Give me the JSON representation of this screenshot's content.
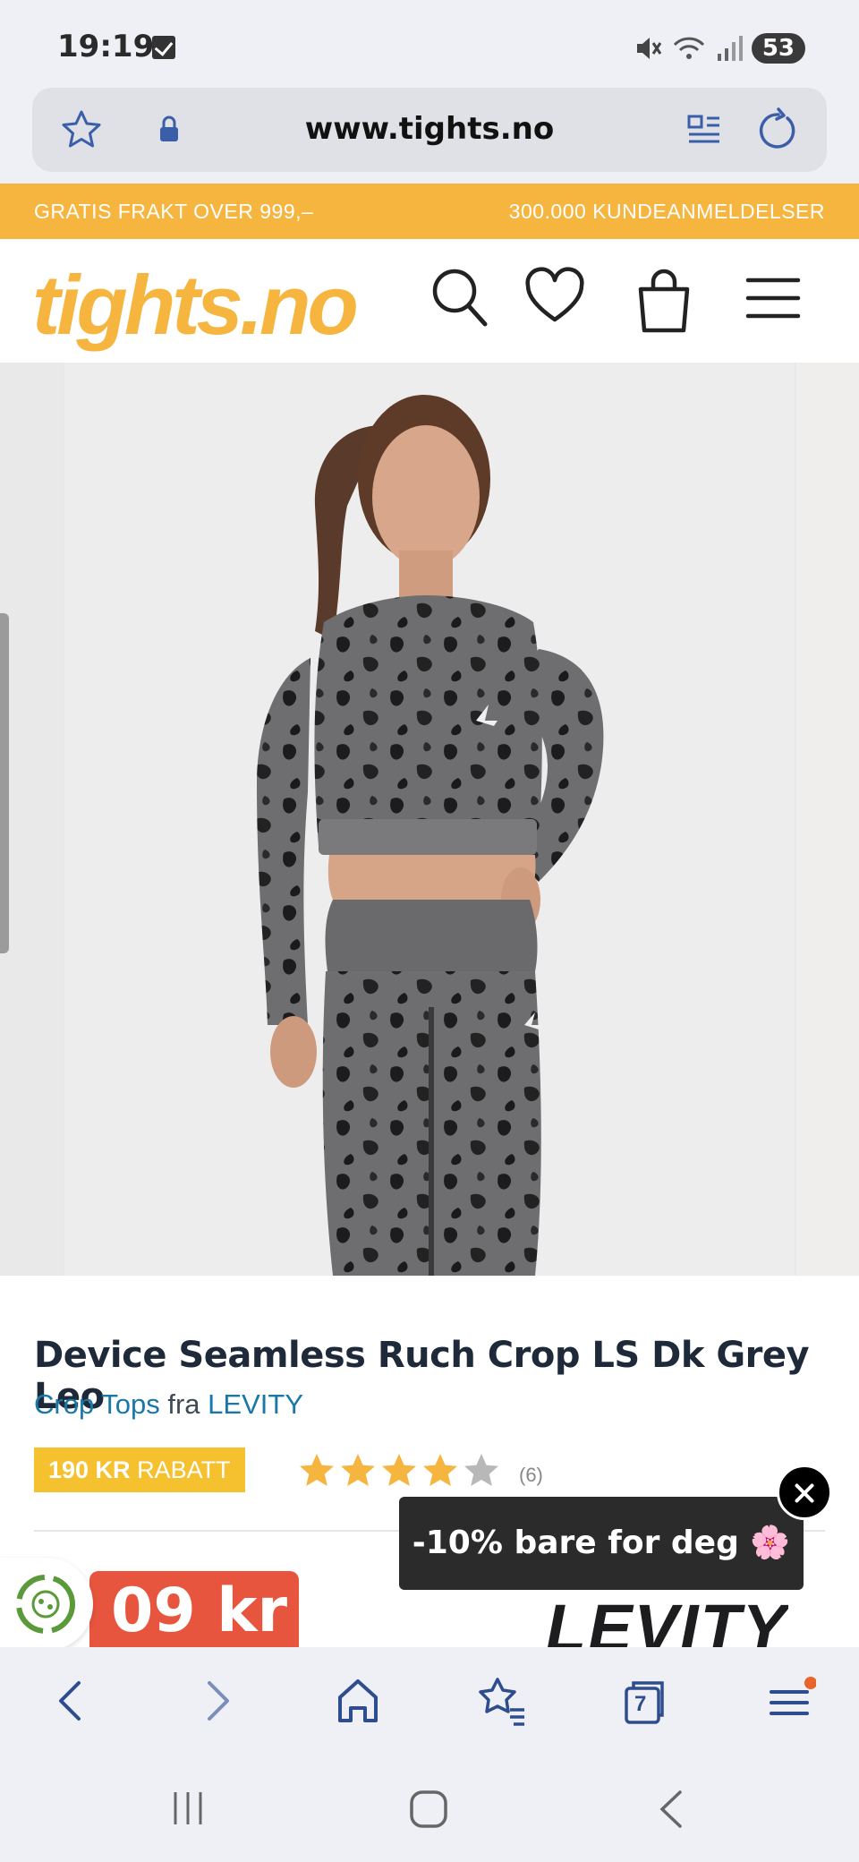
{
  "status": {
    "time": "19:19",
    "battery": "53"
  },
  "browser": {
    "url": "www.tights.no",
    "tab_count": "7"
  },
  "promo": {
    "left": "GRATIS FRAKT OVER 999,–",
    "right": "300.000 KUNDEANMELDELSER"
  },
  "header": {
    "logo": "tights.no"
  },
  "product": {
    "title": "Device Seamless Ruch Crop LS Dk Grey Leo",
    "category": "Crop Tops",
    "from_word": "fra",
    "brand": "LEVITY",
    "discount_amount": "190 KR",
    "discount_word": "RABATT",
    "rating_stars": 4,
    "reviews_count": "(6)",
    "price_partial": "09 kr",
    "brand_logo": "LEVITY"
  },
  "popup": {
    "text": "-10% bare for deg 🌸"
  },
  "colors": {
    "accent": "#f6b53f",
    "link": "#1a78a8",
    "price": "#e8553e",
    "badge": "#f6c12f",
    "nav_blue": "#2e4d8e"
  }
}
